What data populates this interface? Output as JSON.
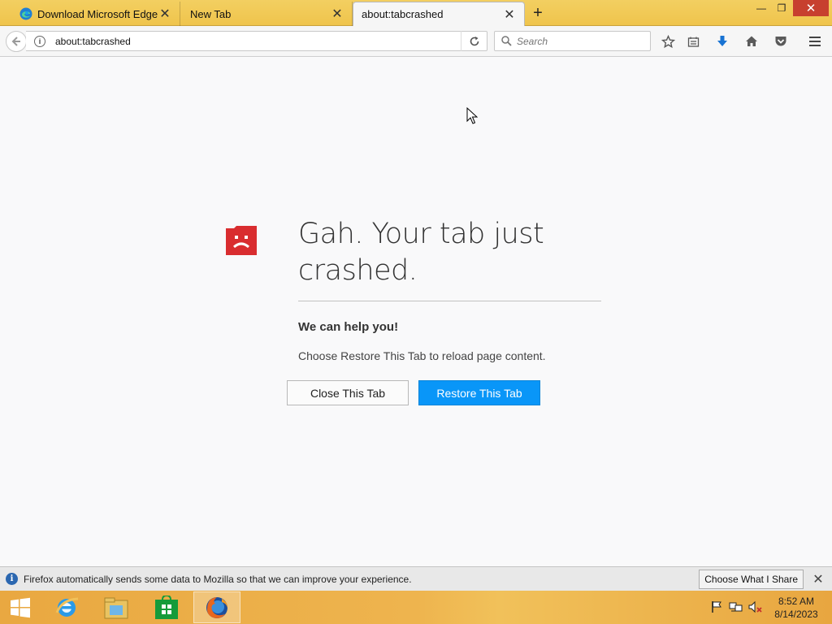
{
  "tabs": [
    {
      "title": "Download Microsoft Edge",
      "favicon": "edge-icon"
    },
    {
      "title": "New Tab",
      "favicon": ""
    },
    {
      "title": "about:tabcrashed",
      "favicon": "",
      "active": true
    }
  ],
  "new_tab_symbol": "+",
  "window": {
    "minimize": "—",
    "restore": "❐",
    "close": "✕"
  },
  "navbar": {
    "url": "about:tabcrashed",
    "search_placeholder": "Search"
  },
  "crash_page": {
    "headline": "Gah. Your tab just crashed.",
    "subhead": "We can help you!",
    "description": "Choose Restore This Tab to reload page content.",
    "close_button": "Close This Tab",
    "restore_button": "Restore This Tab",
    "icon": "sad-tab-icon",
    "icon_color": "#d92d2f",
    "restore_color": "#0996f8"
  },
  "notification": {
    "message": "Firefox automatically sends some data to Mozilla so that we can improve your experience.",
    "button": "Choose What I Share"
  },
  "taskbar": {
    "apps": [
      "start-icon",
      "internet-explorer-icon",
      "file-explorer-icon",
      "store-icon",
      "firefox-icon"
    ],
    "time": "8:52 AM",
    "date": "8/14/2023"
  }
}
